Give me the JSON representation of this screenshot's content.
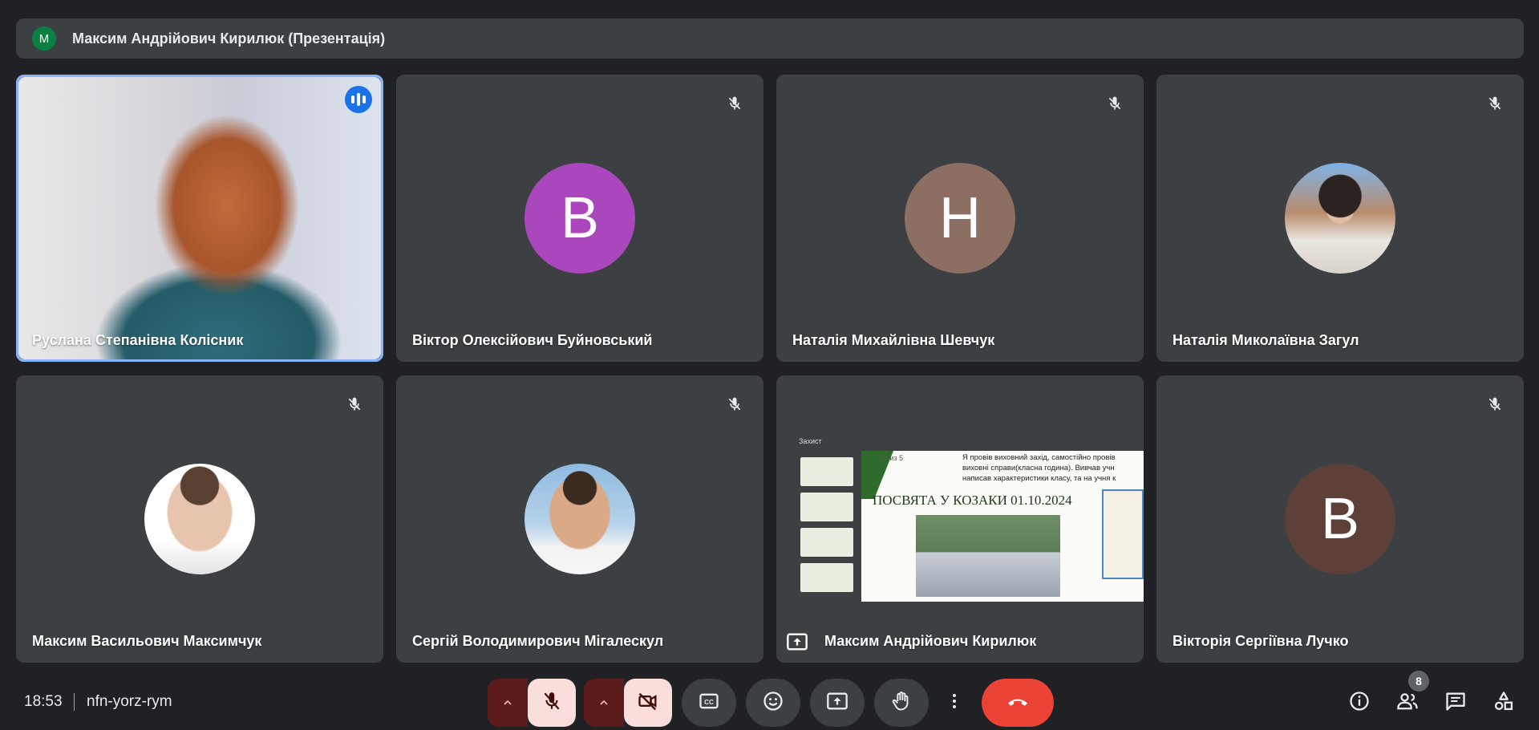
{
  "presenter": {
    "avatar_letter": "M",
    "title": "Максим Андрійович Кирилюк (Презентація)"
  },
  "tiles": [
    {
      "name": "Руслана Степанівна Колісник",
      "kind": "video",
      "speaking": true
    },
    {
      "name": "Віктор Олексійович Буйновський",
      "kind": "letter",
      "letter": "В",
      "color": "#ab47bc",
      "muted": true
    },
    {
      "name": "Наталія Михайлівна Шевчук",
      "kind": "letter",
      "letter": "Н",
      "color": "#8d6e63",
      "muted": true
    },
    {
      "name": "Наталія Миколаївна Загул",
      "kind": "photo",
      "muted": true
    },
    {
      "name": "Максим Васильович Максимчук",
      "kind": "photo",
      "muted": true
    },
    {
      "name": "Сергій Володимирович Мігалескул",
      "kind": "photo",
      "muted": true
    },
    {
      "name": "Максим Андрійович Кирилюк",
      "kind": "screen"
    },
    {
      "name": "Вікторія Сергіївна Лучко",
      "kind": "letter",
      "letter": "В",
      "color": "#5d4037",
      "muted": true
    }
  ],
  "screen_share": {
    "app_tab": "Захист",
    "slide_counter": "5 из 5",
    "slide_title": "ПОСВЯТА У КОЗАКИ 01.10.2024",
    "slide_text": "Я провів виховний захід, самостійно провів виховні справи(класна година). Вивчав учн написав характеристики класу, та на учня к"
  },
  "bottom_bar": {
    "time": "18:53",
    "meeting_code": "nfn-yorz-rym",
    "participants_count": "8"
  },
  "colors": {
    "background": "#202124",
    "tile": "#3c4043",
    "accent_blue": "#1a73e8",
    "end_call": "#ea4335",
    "muted_btn_bg": "#f9dedc",
    "muted_caret_bg": "#5c1b1b"
  },
  "icons": {
    "mic_off": "mic-off-icon",
    "camera_off": "camera-off-icon",
    "captions": "captions-icon",
    "emoji": "emoji-icon",
    "present": "present-icon",
    "raise_hand": "hand-icon",
    "more": "more-vert-icon",
    "end_call": "end-call-icon",
    "info": "info-icon",
    "people": "people-icon",
    "chat": "chat-icon",
    "activities": "activities-icon"
  }
}
